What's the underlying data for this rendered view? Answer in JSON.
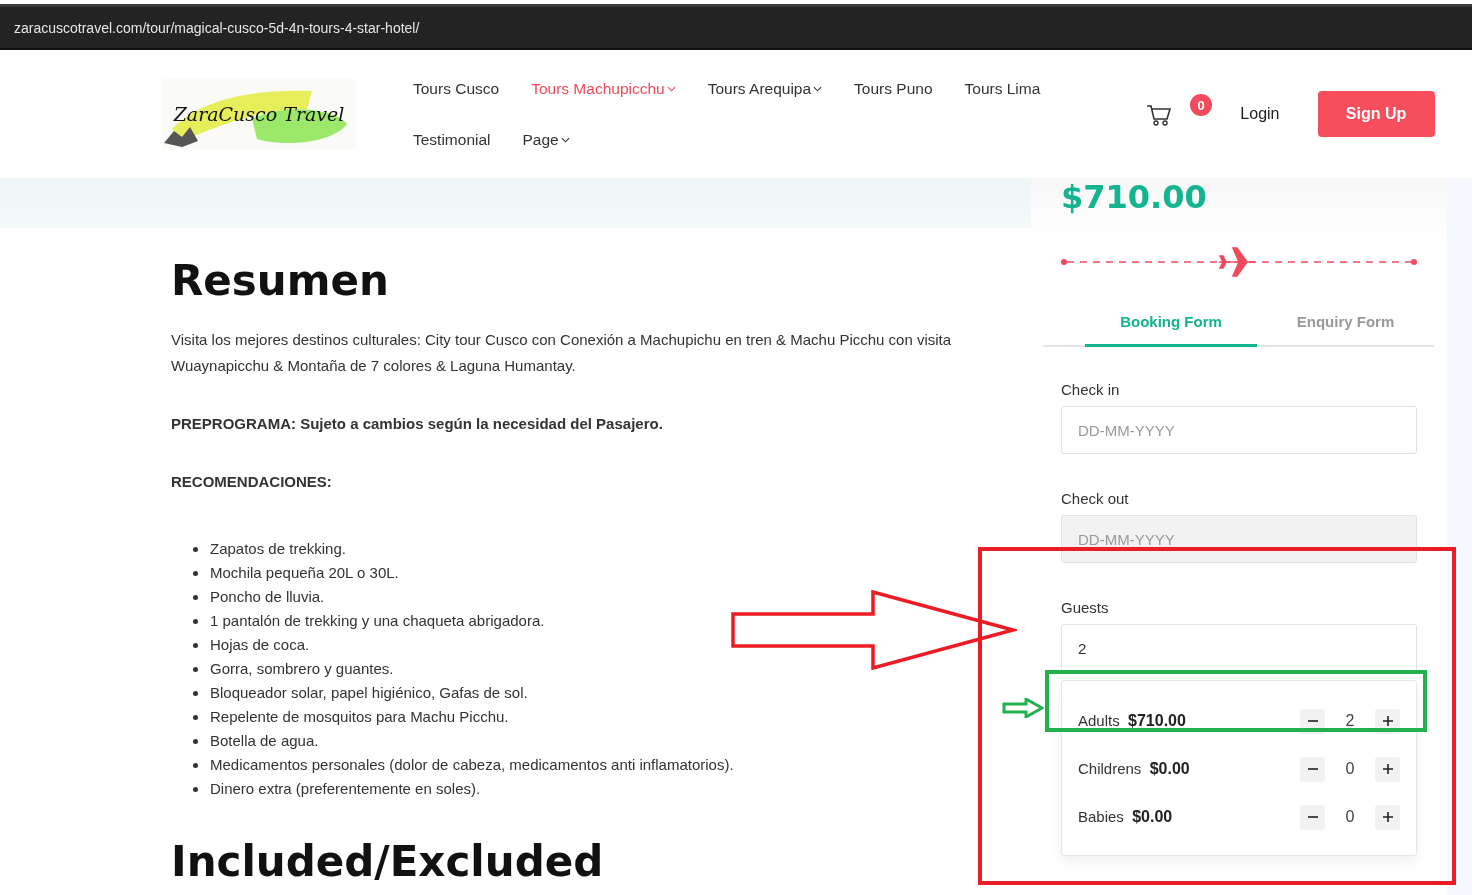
{
  "browser": {
    "url": "zaracuscotravel.com/tour/magical-cusco-5d-4n-tours-4-star-hotel/"
  },
  "header": {
    "logo": {
      "text": "ZaraCusco Travel"
    },
    "nav": [
      {
        "label": "Tours Cusco",
        "selected": false,
        "has_dropdown": false
      },
      {
        "label": "Tours Machupicchu",
        "selected": true,
        "has_dropdown": true
      },
      {
        "label": "Tours Arequipa",
        "selected": false,
        "has_dropdown": true
      },
      {
        "label": "Tours Puno",
        "selected": false,
        "has_dropdown": false
      },
      {
        "label": "Tours Lima",
        "selected": false,
        "has_dropdown": false
      },
      {
        "label": "Testimonial",
        "selected": false,
        "has_dropdown": false
      },
      {
        "label": "Page",
        "selected": false,
        "has_dropdown": true
      }
    ],
    "cart_count": "0",
    "login": "Login",
    "signup": "Sign Up"
  },
  "content": {
    "heading": "Resumen",
    "intro": "Visita los mejores destinos culturales: City tour Cusco con Conexión a Machupichu en tren & Machu Picchu con visita Wuaynapicchu & Montaña de 7 colores & Laguna Humantay.",
    "preprogram": "PREPROGRAMA: Sujeto a cambios según la necesidad del Pasajero.",
    "recommendations_title": "RECOMENDACIONES:",
    "recommendations": [
      "Zapatos de trekking.",
      "Mochila pequeña 20L o 30L.",
      "Poncho de lluvia.",
      "1 pantalón de trekking y una chaqueta abrigadora.",
      "Hojas de coca.",
      "Gorra, sombrero y guantes.",
      "Bloqueador solar, papel higiénico, Gafas de sol.",
      "Repelente de mosquitos para Machu Picchu.",
      "Botella de agua.",
      "Medicamentos personales (dolor de cabeza, medicamentos anti inflamatorios).",
      "Dinero extra (preferentemente en soles)."
    ],
    "heading_2": "Included/Excluded"
  },
  "sidebar": {
    "price": "$710.00",
    "tabs": [
      {
        "label": "Booking Form",
        "selected": true
      },
      {
        "label": "Enquiry Form",
        "selected": false
      }
    ],
    "fields": [
      {
        "label": "Check in",
        "placeholder": "DD-MM-YYYY",
        "disabled": false
      },
      {
        "label": "Check out",
        "placeholder": "DD-MM-YYYY",
        "disabled": true
      }
    ],
    "guests": {
      "label": "Guests",
      "value": "2",
      "types": [
        {
          "label": "Adults",
          "price": "$710.00",
          "count": "2"
        },
        {
          "label": "Childrens",
          "price": "$0.00",
          "count": "0"
        },
        {
          "label": "Babies",
          "price": "$0.00",
          "count": "0"
        }
      ]
    }
  }
}
